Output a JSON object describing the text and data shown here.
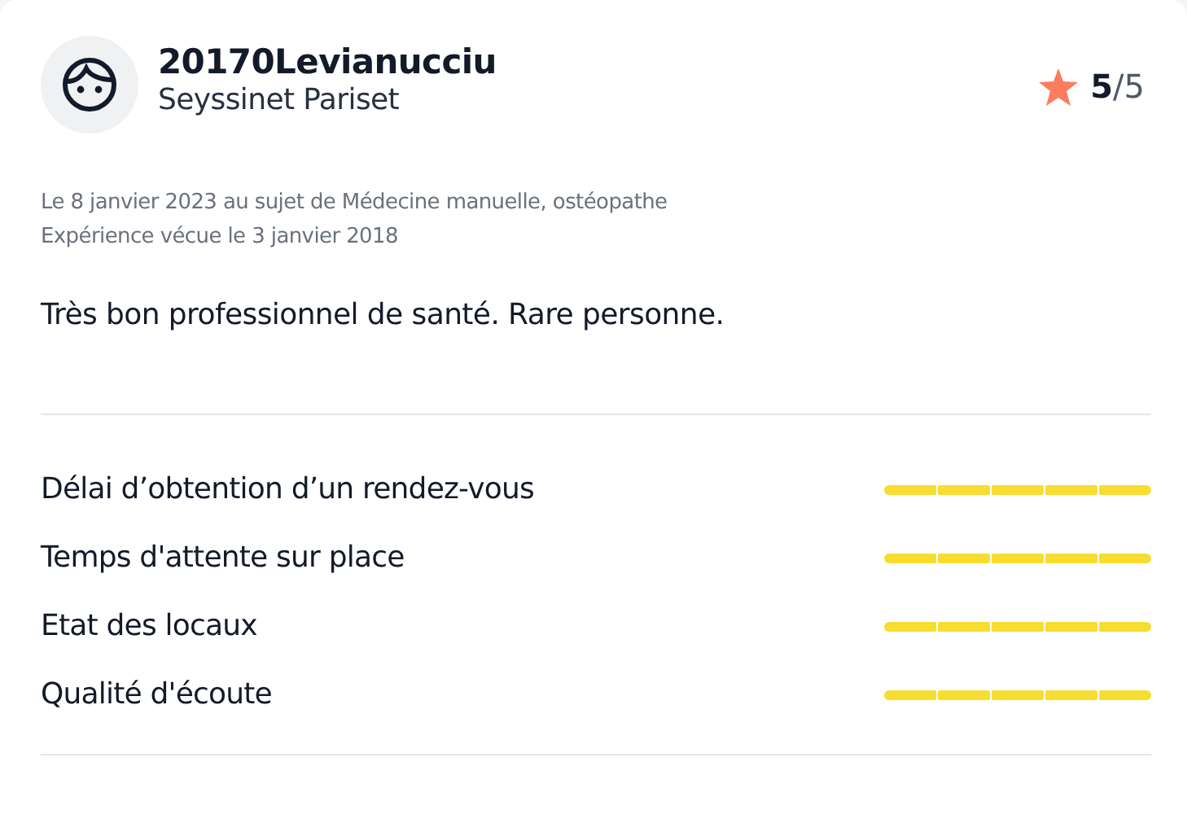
{
  "author": {
    "name": "20170Levianucciu",
    "location": "Seyssinet Pariset"
  },
  "rating": {
    "score": "5",
    "max": "/5"
  },
  "meta": [
    "Le 8 janvier 2023 au sujet de Médecine manuelle, ostéopathe",
    "Expérience vécue le 3 janvier 2018"
  ],
  "comment": "Très bon professionnel de santé. Rare personne.",
  "criteria": [
    {
      "label": "Délai d’obtention d’un rendez-vous",
      "stars": 5
    },
    {
      "label": "Temps d'attente sur place",
      "stars": 5
    },
    {
      "label": "Etat des locaux",
      "stars": 5
    },
    {
      "label": "Qualité d'écoute",
      "stars": 5
    }
  ]
}
